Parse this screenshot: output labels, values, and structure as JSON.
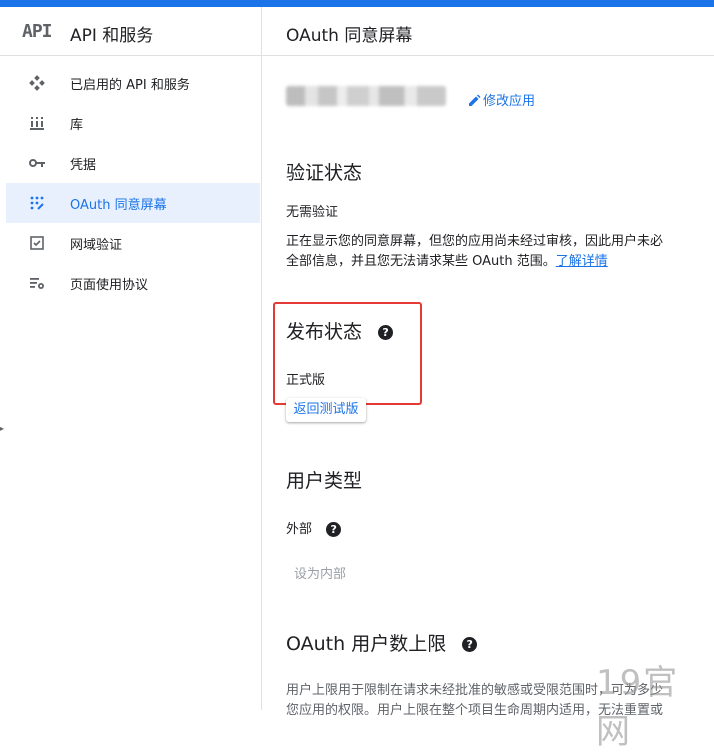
{
  "app": {
    "logo_text": "API",
    "title": "API 和服务"
  },
  "sidebar": {
    "items": [
      {
        "label": "已启用的 API 和服务",
        "icon": "api-diamond-icon",
        "active": false
      },
      {
        "label": "库",
        "icon": "library-icon",
        "active": false
      },
      {
        "label": "凭据",
        "icon": "key-icon",
        "active": false
      },
      {
        "label": "OAuth 同意屏幕",
        "icon": "consent-dots-icon",
        "active": true
      },
      {
        "label": "网域验证",
        "icon": "checkbox-icon",
        "active": false
      },
      {
        "label": "页面使用协议",
        "icon": "settings-list-icon",
        "active": false
      }
    ]
  },
  "main": {
    "title": "OAuth 同意屏幕",
    "edit_app_label": "修改应用",
    "verification": {
      "heading": "验证状态",
      "status": "无需验证",
      "description_line1": "正在显示您的同意屏幕，但您的应用尚未经过审核，因此用户未必",
      "description_line2": "全部信息，并且您无法请求某些 OAuth 范围。",
      "learn_more": "了解详情"
    },
    "publishing": {
      "heading": "发布状态",
      "status": "正式版",
      "back_to_testing": "返回测试版"
    },
    "user_type": {
      "heading": "用户类型",
      "value": "外部",
      "make_internal": "设为内部"
    },
    "user_cap": {
      "heading": "OAuth 用户数上限",
      "line1": "用户上限用于限制在请求未经批准的敏感或受限范围时，可为多少",
      "line2": "您应用的权限。用户上限在整个项目生命周期内适用，无法重置或"
    }
  },
  "watermark": "19官网",
  "colors": {
    "accent": "#1a73e8",
    "active_bg": "#e8f0fe",
    "highlight_box": "#e53935",
    "topbar": "#1a73e8"
  }
}
